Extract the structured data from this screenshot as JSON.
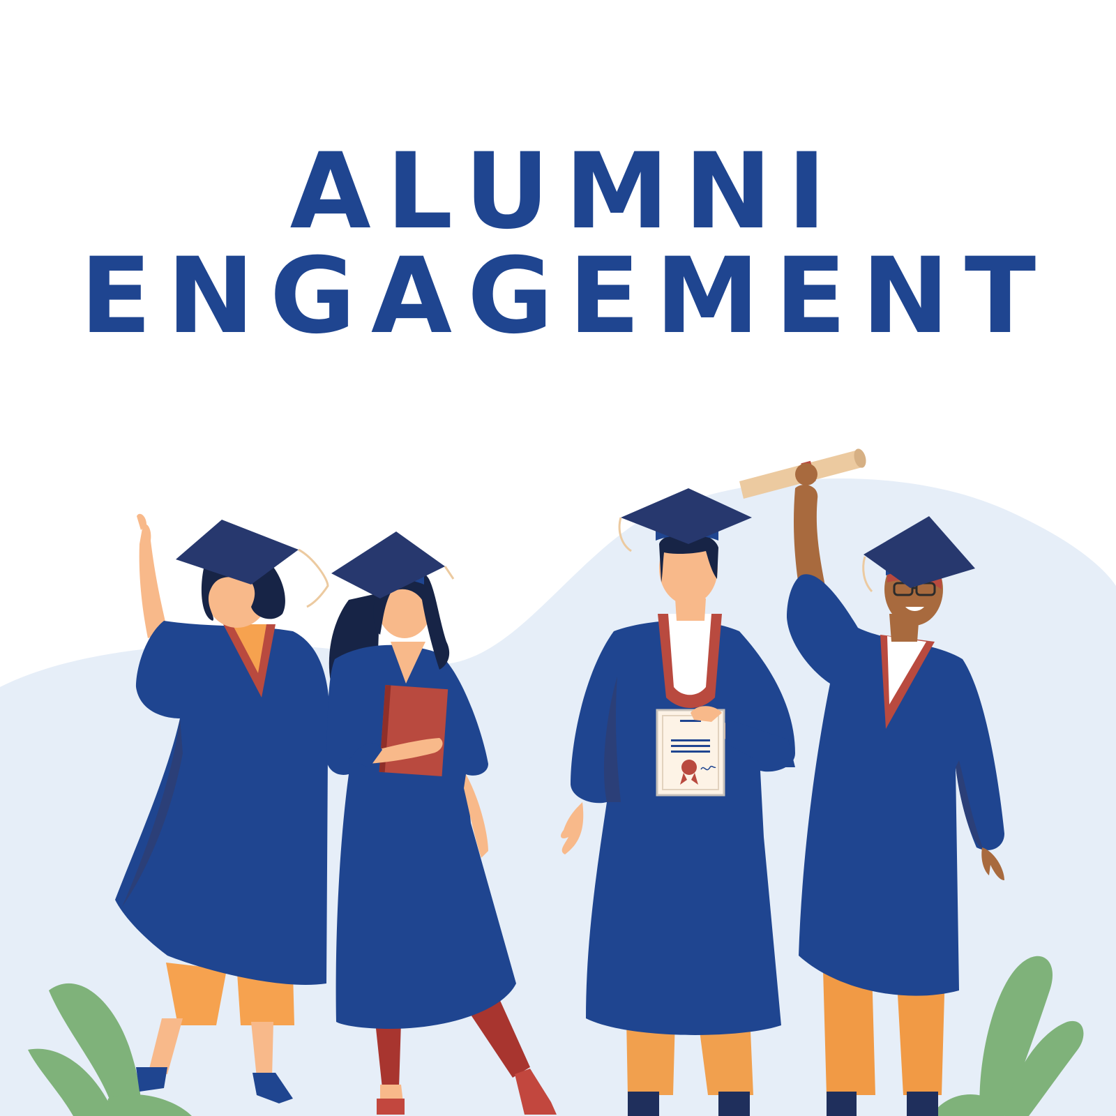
{
  "title": {
    "line1": "ALUMNI",
    "line2": "ENGAGEMENT"
  },
  "colors": {
    "title": "#1f4590",
    "gown": "#1f4590",
    "gown_shadow": "#2b3f78",
    "cap": "#27386e",
    "stole": "#b94a3f",
    "background_hill": "#e6eef8",
    "plants": "#7fb27a",
    "orange_pants": "#f19a45",
    "diploma": "#eccaa0"
  },
  "illustration": {
    "graduates": [
      {
        "id": "graduate-1",
        "pose": "waving"
      },
      {
        "id": "graduate-2",
        "pose": "holding book"
      },
      {
        "id": "graduate-3",
        "pose": "holding certificate"
      },
      {
        "id": "graduate-4",
        "pose": "raising diploma"
      }
    ],
    "icons": [
      "graduation-cap-icon",
      "diploma-scroll-icon",
      "certificate-icon",
      "book-icon",
      "plant-leaves-icon"
    ]
  }
}
